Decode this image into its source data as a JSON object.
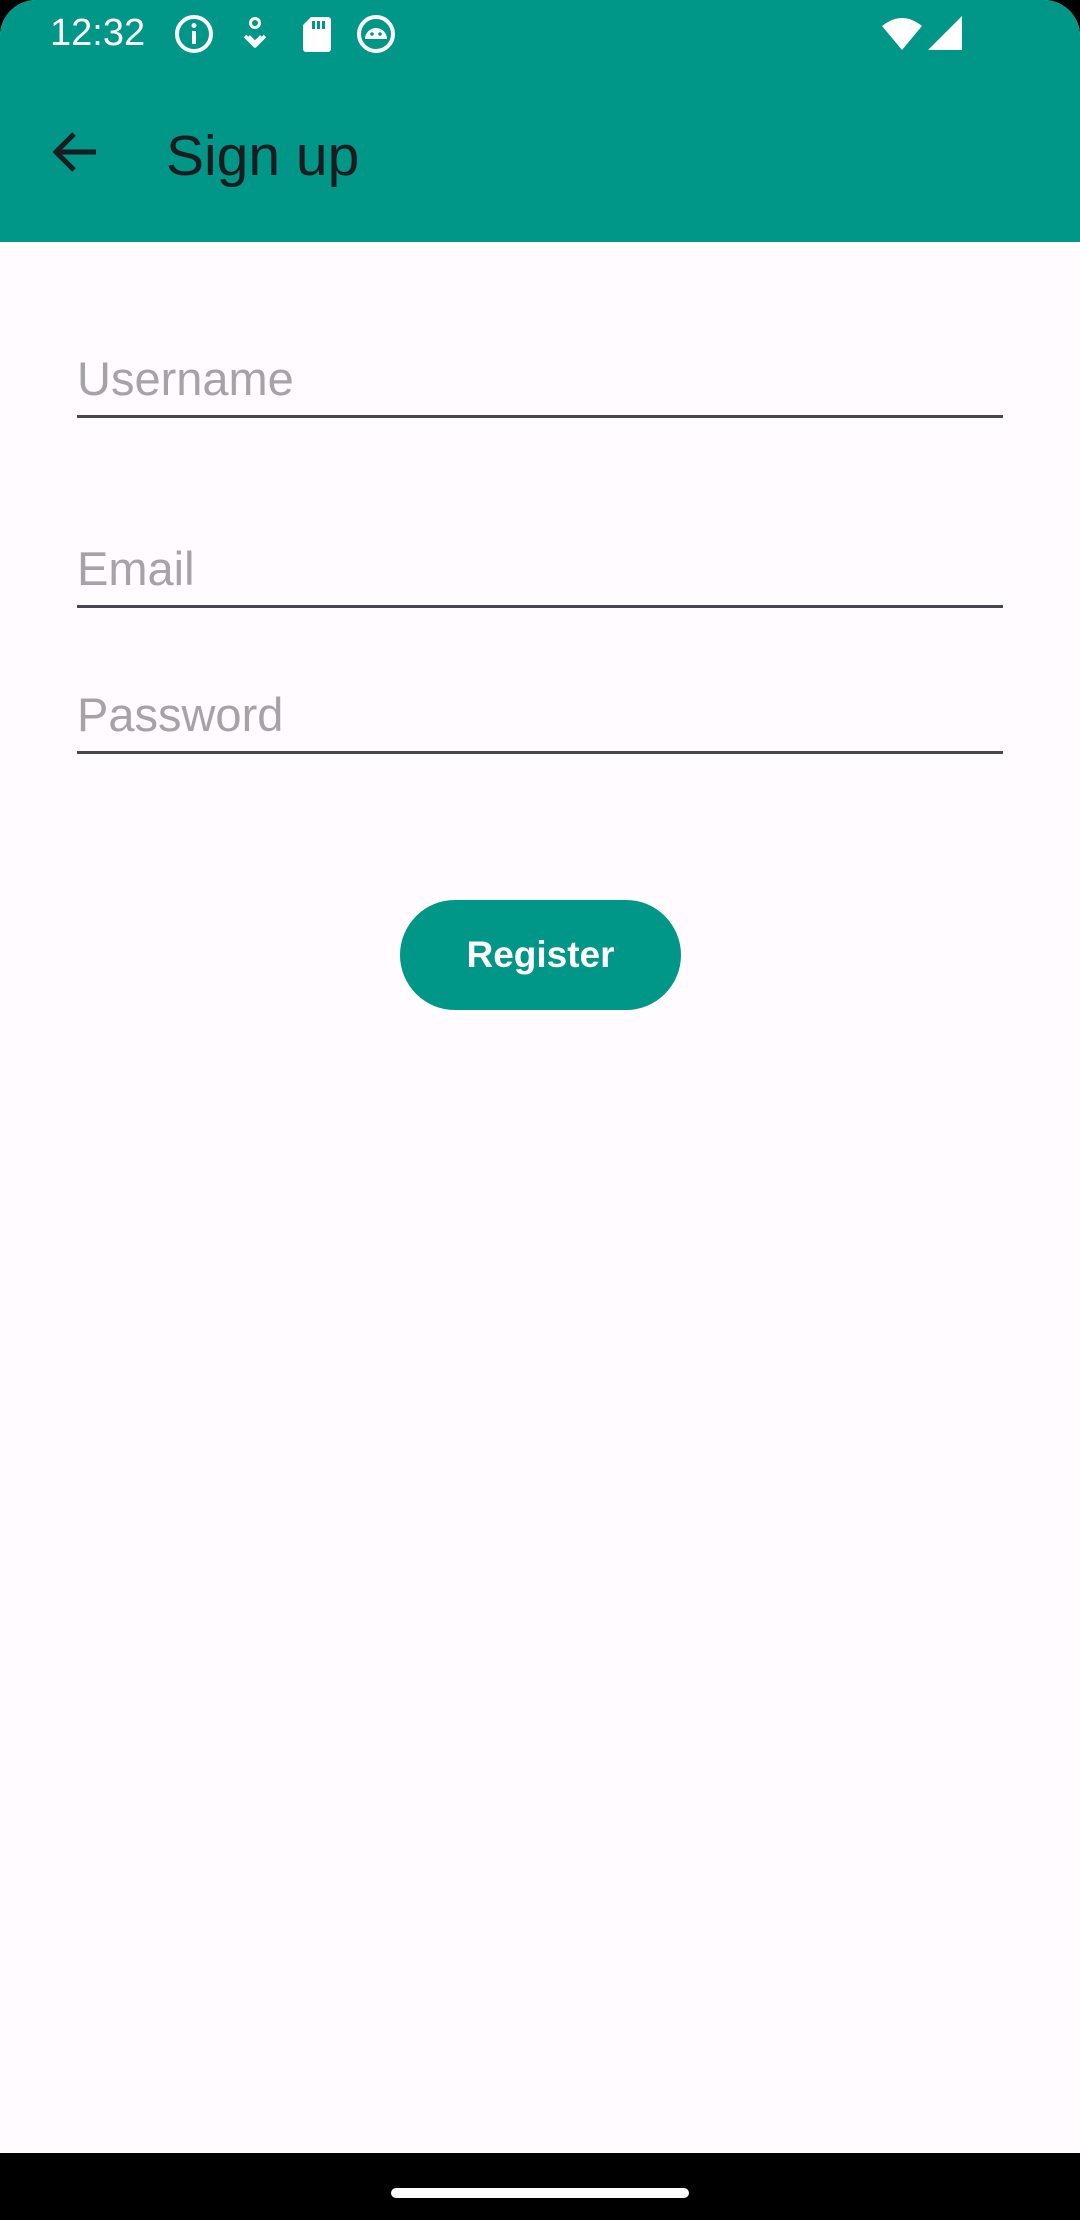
{
  "status_bar": {
    "time": "12:32",
    "icons": [
      "info-icon",
      "location-pin-icon",
      "sd-card-icon",
      "android-debug-icon",
      "wifi-icon",
      "signal-icon"
    ]
  },
  "toolbar": {
    "title": "Sign up",
    "back_icon": "arrow-back-icon"
  },
  "form": {
    "username": {
      "value": "",
      "placeholder": "Username"
    },
    "email": {
      "value": "",
      "placeholder": "Email"
    },
    "password": {
      "value": "",
      "placeholder": "Password"
    },
    "register_label": "Register"
  },
  "colors": {
    "primary": "#009688",
    "background": "#fffbfe",
    "on_surface": "#1c1b1f",
    "hint": "#a5a3a8"
  }
}
